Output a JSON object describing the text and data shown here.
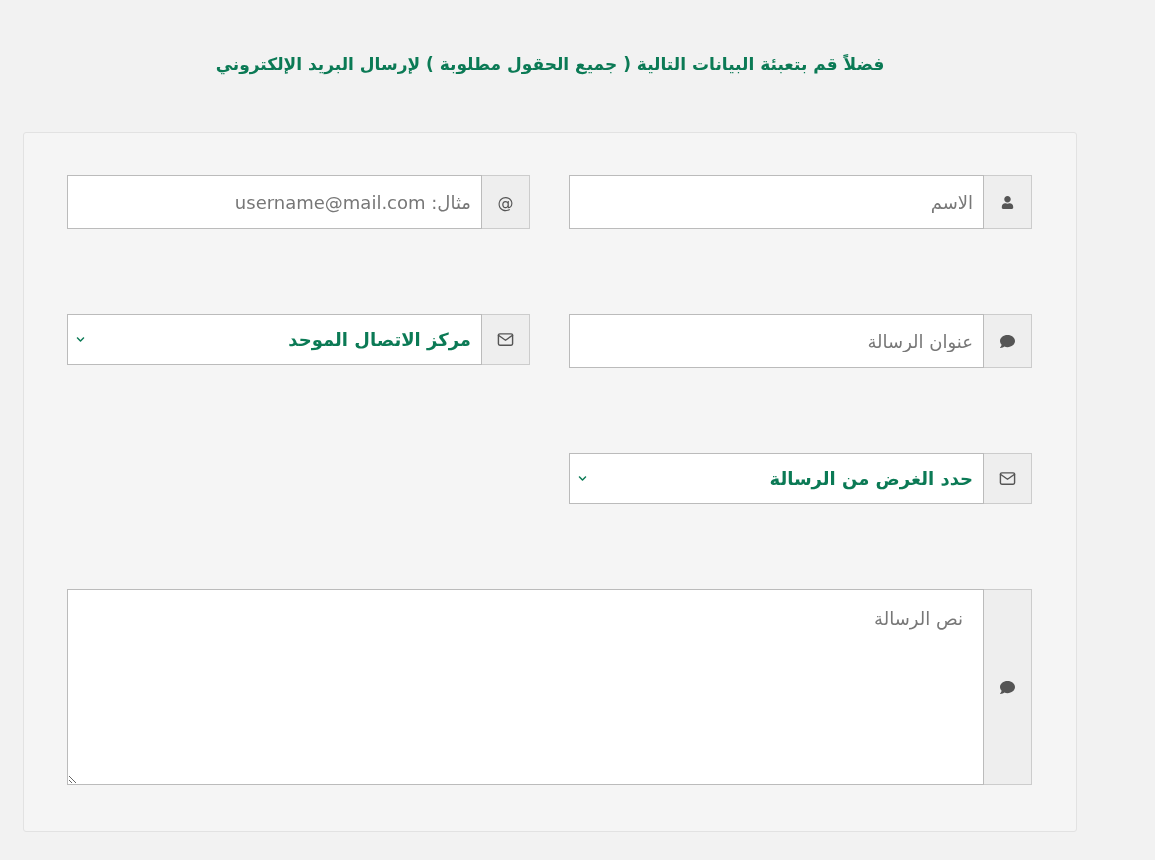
{
  "heading": "فضلاً قم بتعبئة البيانات التالية ( جميع الحقول مطلوبة ) لإرسال البريد الإلكتروني",
  "fields": [
    {
      "kind": "input",
      "placeholder": "الاسم"
    },
    {
      "kind": "input",
      "addon_text": "@",
      "placeholder": "مثال: username@mail.com"
    },
    {
      "kind": "input",
      "placeholder": "عنوان الرسالة"
    },
    {
      "kind": "select",
      "value": "مركز الاتصال الموحد"
    },
    {
      "kind": "select",
      "value": "حدد الغرض من الرسالة"
    },
    {
      "kind": "textarea",
      "placeholder": "نص الرسالة"
    }
  ]
}
